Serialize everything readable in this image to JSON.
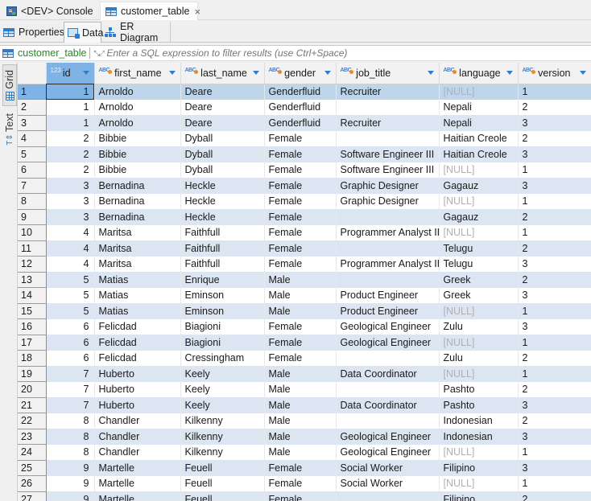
{
  "top_tabs": [
    {
      "label": "<DEV> Console",
      "icon": "console-icon",
      "active": false
    },
    {
      "label": "customer_table",
      "icon": "table-icon",
      "active": true,
      "close": "×"
    }
  ],
  "sub_tabs": [
    {
      "label": "Properties",
      "icon": "table-icon",
      "active": false
    },
    {
      "label": "Data",
      "icon": "data-icon",
      "active": true
    },
    {
      "label": "ER Diagram",
      "icon": "er-diagram-icon",
      "active": false
    }
  ],
  "filter": {
    "table_name": "customer_table",
    "placeholder": "Enter a SQL expression to filter results (use Ctrl+Space)",
    "value": ""
  },
  "side_tabs": [
    {
      "label": "Grid",
      "icon": "grid-icon",
      "active": true
    },
    {
      "label": "Text",
      "icon": "text-icon",
      "active": false
    }
  ],
  "columns": [
    {
      "name": "id",
      "type": "123"
    },
    {
      "name": "first_name",
      "type": "ABC"
    },
    {
      "name": "last_name",
      "type": "ABC"
    },
    {
      "name": "gender",
      "type": "ABC"
    },
    {
      "name": "job_title",
      "type": "ABC"
    },
    {
      "name": "language",
      "type": "ABC"
    },
    {
      "name": "version",
      "type": "ABC"
    }
  ],
  "null_label": "[NULL]",
  "rows": [
    [
      "1",
      "1",
      "Arnoldo",
      "Deare",
      "Genderfluid",
      "Recruiter",
      null,
      "1"
    ],
    [
      "2",
      "1",
      "Arnoldo",
      "Deare",
      "Genderfluid",
      "",
      "Nepali",
      "2"
    ],
    [
      "3",
      "1",
      "Arnoldo",
      "Deare",
      "Genderfluid",
      "Recruiter",
      "Nepali",
      "3"
    ],
    [
      "4",
      "2",
      "Bibbie",
      "Dyball",
      "Female",
      "",
      "Haitian Creole",
      "2"
    ],
    [
      "5",
      "2",
      "Bibbie",
      "Dyball",
      "Female",
      "Software Engineer III",
      "Haitian Creole",
      "3"
    ],
    [
      "6",
      "2",
      "Bibbie",
      "Dyball",
      "Female",
      "Software Engineer III",
      null,
      "1"
    ],
    [
      "7",
      "3",
      "Bernadina",
      "Heckle",
      "Female",
      "Graphic Designer",
      "Gagauz",
      "3"
    ],
    [
      "8",
      "3",
      "Bernadina",
      "Heckle",
      "Female",
      "Graphic Designer",
      null,
      "1"
    ],
    [
      "9",
      "3",
      "Bernadina",
      "Heckle",
      "Female",
      "",
      "Gagauz",
      "2"
    ],
    [
      "10",
      "4",
      "Maritsa",
      "Faithfull",
      "Female",
      "Programmer Analyst II",
      null,
      "1"
    ],
    [
      "11",
      "4",
      "Maritsa",
      "Faithfull",
      "Female",
      "",
      "Telugu",
      "2"
    ],
    [
      "12",
      "4",
      "Maritsa",
      "Faithfull",
      "Female",
      "Programmer Analyst II",
      "Telugu",
      "3"
    ],
    [
      "13",
      "5",
      "Matias",
      "Enrique",
      "Male",
      "",
      "Greek",
      "2"
    ],
    [
      "14",
      "5",
      "Matias",
      "Eminson",
      "Male",
      "Product Engineer",
      "Greek",
      "3"
    ],
    [
      "15",
      "5",
      "Matias",
      "Eminson",
      "Male",
      "Product Engineer",
      null,
      "1"
    ],
    [
      "16",
      "6",
      "Felicdad",
      "Biagioni",
      "Female",
      "Geological Engineer",
      "Zulu",
      "3"
    ],
    [
      "17",
      "6",
      "Felicdad",
      "Biagioni",
      "Female",
      "Geological Engineer",
      null,
      "1"
    ],
    [
      "18",
      "6",
      "Felicdad",
      "Cressingham",
      "Female",
      "",
      "Zulu",
      "2"
    ],
    [
      "19",
      "7",
      "Huberto",
      "Keely",
      "Male",
      "Data Coordinator",
      null,
      "1"
    ],
    [
      "20",
      "7",
      "Huberto",
      "Keely",
      "Male",
      "",
      "Pashto",
      "2"
    ],
    [
      "21",
      "7",
      "Huberto",
      "Keely",
      "Male",
      "Data Coordinator",
      "Pashto",
      "3"
    ],
    [
      "22",
      "8",
      "Chandler",
      "Kilkenny",
      "Male",
      "",
      "Indonesian",
      "2"
    ],
    [
      "23",
      "8",
      "Chandler",
      "Kilkenny",
      "Male",
      "Geological Engineer",
      "Indonesian",
      "3"
    ],
    [
      "24",
      "8",
      "Chandler",
      "Kilkenny",
      "Male",
      "Geological Engineer",
      null,
      "1"
    ],
    [
      "25",
      "9",
      "Martelle",
      "Feuell",
      "Female",
      "Social Worker",
      "Filipino",
      "3"
    ],
    [
      "26",
      "9",
      "Martelle",
      "Feuell",
      "Female",
      "Social Worker",
      null,
      "1"
    ],
    [
      "27",
      "9",
      "Martelle",
      "Feuell",
      "Female",
      "",
      "Filipino",
      "2"
    ]
  ],
  "selection": {
    "row": 1,
    "column": "id"
  }
}
